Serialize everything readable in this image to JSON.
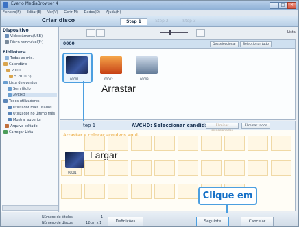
{
  "window": {
    "title": "Everio MediaBrowser 4"
  },
  "menu": [
    "Ficheiro(F)",
    "Editar(E)",
    "Ver(V)",
    "Gerir(M)",
    "Dados(D)",
    "Ajuda(H)"
  ],
  "header": {
    "title": "Criar disco",
    "steps": [
      "Step 1",
      "Step 2",
      "Step 3"
    ]
  },
  "sidebar": {
    "devices_title": "Dispositivo",
    "devices": [
      "Videocâmara(USB)",
      "Disco removível(F:)"
    ],
    "library_title": "Biblioteca",
    "library": [
      "Todas as mid.",
      "Calendário",
      "2010",
      "5.2010(3)",
      "Lista de eventos",
      "Sem título",
      "AVCHD",
      "Todos utilizadores",
      "Utilizador mais usados",
      "Utilizador no último mês",
      "Mostrar superior",
      "Arquivo editado",
      "Carregar Lista"
    ]
  },
  "toolbar": {
    "zoom_label": "Lista"
  },
  "top_pane": {
    "title": "0000",
    "buttons": [
      "Desseleccionar",
      "Seleccionar tudo"
    ],
    "thumbs": [
      {
        "caption": "00001",
        "color": "#2a3f7a"
      },
      {
        "caption": "00002",
        "color": "#e46a1f"
      },
      {
        "caption": "00003",
        "color": "#8aa1bd"
      }
    ]
  },
  "lower_pane": {
    "step": "tep 1",
    "title": "AVCHD: Seleccionar candidatos",
    "buttons": [
      "Eliminar seleccionados",
      "Eliminar todos"
    ],
    "hint": "Arrastar e colocar arquivos aqui.",
    "thumb_caption": "00001"
  },
  "annotations": {
    "drag": "Arrastar",
    "drop": "Largar",
    "click": "Clique em"
  },
  "bottom": {
    "titles_label": "Número de títulos:",
    "titles_value": "1",
    "discs_label": "Número de discos:",
    "discs_value": "12cm x 1",
    "settings": "Definições",
    "next": "Seguinte",
    "cancel": "Cancelar"
  },
  "colors": {
    "accent": "#4c9fe0",
    "hint": "#f0c070"
  }
}
